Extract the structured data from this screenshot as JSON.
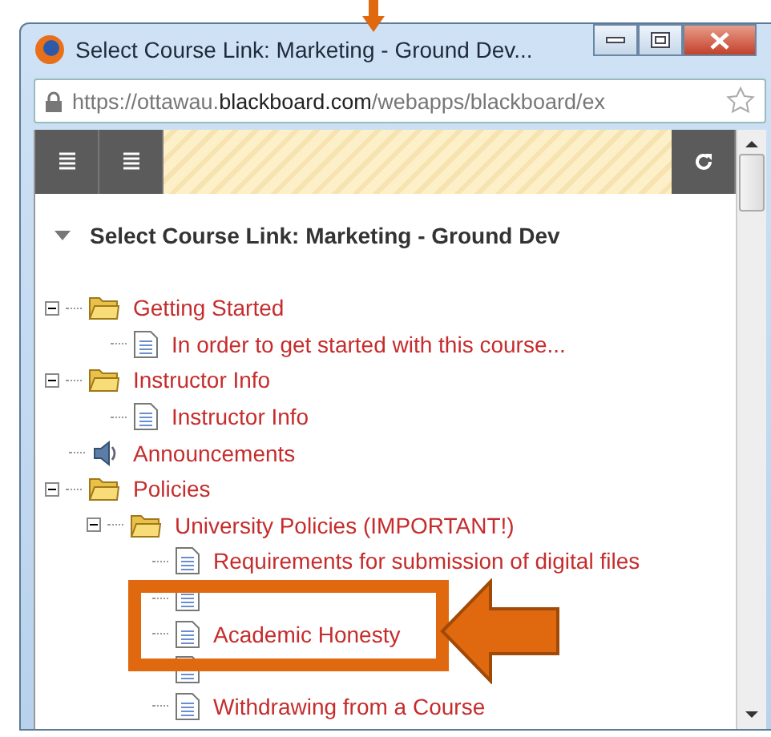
{
  "window": {
    "title": "Select Course Link: Marketing - Ground Dev...",
    "url": {
      "prefix": "https://ottawau.",
      "domain": "blackboard.com",
      "path": "/webapps/blackboard/ex"
    }
  },
  "panel": {
    "heading": "Select Course Link: Marketing - Ground Dev",
    "expanded": true
  },
  "tree": [
    {
      "kind": "folder",
      "label": "Getting Started",
      "expanded": true,
      "children": [
        {
          "kind": "document",
          "label": "In order to get started with this course..."
        }
      ]
    },
    {
      "kind": "folder",
      "label": "Instructor Info",
      "expanded": true,
      "children": [
        {
          "kind": "document",
          "label": "Instructor Info"
        }
      ]
    },
    {
      "kind": "announcement",
      "label": "Announcements"
    },
    {
      "kind": "folder",
      "label": "Policies",
      "expanded": true,
      "children": [
        {
          "kind": "folder",
          "label": "University Policies (IMPORTANT!)",
          "expanded": true,
          "children": [
            {
              "kind": "document",
              "label": "Requirements for submission of digital files"
            },
            {
              "kind": "document"
            },
            {
              "kind": "document",
              "label": "Academic Honesty"
            },
            {
              "kind": "document"
            },
            {
              "kind": "document",
              "label": "Withdrawing from a Course"
            }
          ]
        }
      ]
    }
  ]
}
